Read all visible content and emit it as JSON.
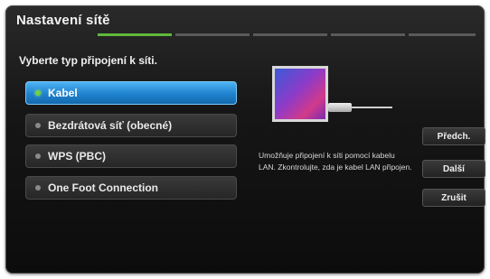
{
  "window": {
    "title": "Nastavení sítě",
    "progress": {
      "total_steps": 5,
      "current_step": 1
    }
  },
  "prompt": "Vyberte typ připojení k síti.",
  "options": [
    {
      "label": "Kabel",
      "selected": true
    },
    {
      "label": "Bezdrátová síť (obecné)",
      "selected": false
    },
    {
      "label": "WPS (PBC)",
      "selected": false
    },
    {
      "label": "One Foot Connection",
      "selected": false
    }
  ],
  "illustration": {
    "icon": "lan-cable-tv-icon"
  },
  "description": "Umožňuje připojení k síti pomocí kabelu LAN. Zkontrolujte, zda je kabel LAN připojen.",
  "buttons": {
    "prev": "Předch.",
    "next": "Další",
    "cancel": "Zrušit"
  },
  "colors": {
    "selected_accent": "#1f82cf",
    "progress_active": "#5fb93a",
    "selected_dot": "#6fd23c"
  }
}
